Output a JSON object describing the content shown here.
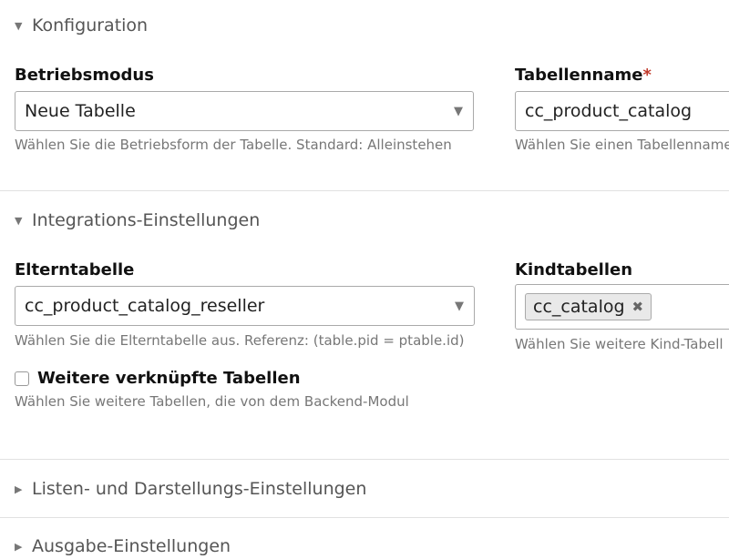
{
  "sections": [
    {
      "label": "Konfiguration",
      "expanded": true
    },
    {
      "label": "Integrations-Einstellungen",
      "expanded": true
    },
    {
      "label": "Listen- und Darstellungs-Einstellungen",
      "expanded": false
    },
    {
      "label": "Ausgabe-Einstellungen",
      "expanded": false
    }
  ],
  "config": {
    "mode_label": "Betriebsmodus",
    "mode_value": "Neue Tabelle",
    "mode_hint": "Wählen Sie die Betriebsform der Tabelle. Standard: Alleinstehen",
    "tablename_label": "Tabellenname",
    "required_mark": "*",
    "tablename_value": "cc_product_catalog",
    "tablename_hint": "Wählen Sie einen Tabellenname"
  },
  "integration": {
    "parent_label": "Elterntabelle",
    "parent_value": "cc_product_catalog_reseller",
    "parent_hint": "Wählen Sie die Elterntabelle aus. Referenz: (table.pid = ptable.id)",
    "children_label": "Kindtabellen",
    "children_chips": [
      "cc_catalog"
    ],
    "children_hint": "Wählen Sie weitere Kind-Tabell",
    "linked_label": "Weitere verknüpfte Tabellen",
    "linked_checked": false,
    "linked_hint": "Wählen Sie weitere Tabellen, die von dem Backend-Modul"
  }
}
